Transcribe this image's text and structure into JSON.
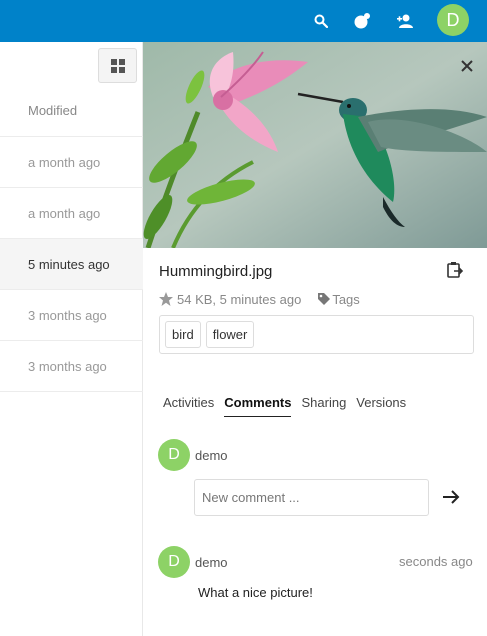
{
  "header": {
    "search_icon": "search-icon",
    "activity_icon": "activity-icon",
    "contacts_icon": "contacts-icon",
    "avatar_initial": "D",
    "avatar_color": "#8dd266",
    "bar_color": "#0082c9"
  },
  "file_list": {
    "column_header": "Modified",
    "rows": [
      {
        "modified": "a month ago",
        "selected": false
      },
      {
        "modified": "a month ago",
        "selected": false
      },
      {
        "modified": "5 minutes ago",
        "selected": true
      },
      {
        "modified": "3 months ago",
        "selected": false
      },
      {
        "modified": "3 months ago",
        "selected": false
      }
    ]
  },
  "details": {
    "filename": "Hummingbird.jpg",
    "size": "54 KB",
    "modified": "5 minutes ago",
    "meta_text": "54 KB, 5 minutes ago",
    "tags_label": "Tags",
    "tags": [
      "bird",
      "flower"
    ],
    "tabs": [
      {
        "label": "Activities",
        "active": false
      },
      {
        "label": "Comments",
        "active": true
      },
      {
        "label": "Sharing",
        "active": false
      },
      {
        "label": "Versions",
        "active": false
      }
    ],
    "current_user": {
      "initial": "D",
      "name": "demo"
    },
    "new_comment_placeholder": "New comment ...",
    "comments": [
      {
        "initial": "D",
        "author": "demo",
        "time": "seconds ago",
        "text": "What a nice picture!"
      }
    ]
  }
}
